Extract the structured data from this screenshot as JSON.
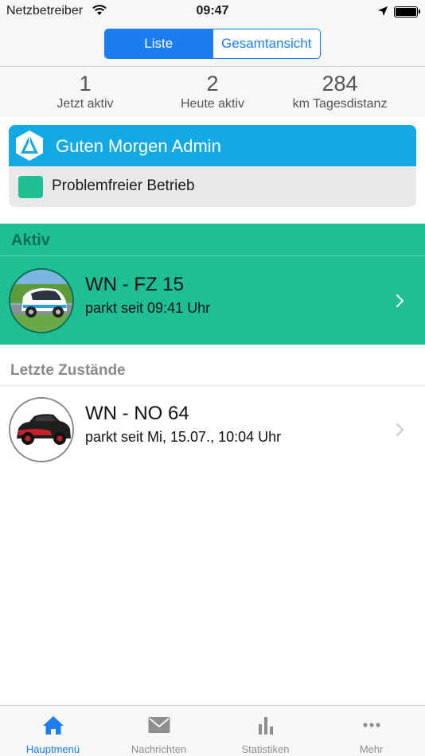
{
  "status_bar": {
    "carrier": "Netzbetreiber",
    "time": "09:47"
  },
  "segment": {
    "tabs": [
      {
        "label": "Liste",
        "active": true
      },
      {
        "label": "Gesamtansicht",
        "active": false
      }
    ]
  },
  "stats": [
    {
      "value": "1",
      "label": "Jetzt aktiv"
    },
    {
      "value": "2",
      "label": "Heute aktiv"
    },
    {
      "value": "284",
      "label": "km Tagesdistanz"
    }
  ],
  "greeting": {
    "title": "Guten Morgen Admin",
    "status_text": "Problemfreier Betrieb",
    "status_color": "#1fbf96",
    "header_color": "#12a9e5"
  },
  "active_section": {
    "header": "Aktiv",
    "color": "#1fbf96",
    "vehicles": [
      {
        "plate": "WN - FZ 15",
        "since": "parkt seit 09:41 Uhr"
      }
    ]
  },
  "last_section": {
    "header": "Letzte Zustände",
    "vehicles": [
      {
        "plate": "WN - NO 64",
        "since": "parkt seit Mi, 15.07., 10:04 Uhr"
      }
    ]
  },
  "tab_bar": {
    "accent": "#1a7ef0",
    "items": [
      {
        "label": "Hauptmenü",
        "icon": "home-icon",
        "active": true
      },
      {
        "label": "Nachrichten",
        "icon": "envelope-icon",
        "active": false
      },
      {
        "label": "Statistiken",
        "icon": "bar-chart-icon",
        "active": false
      },
      {
        "label": "Mehr",
        "icon": "more-dots-icon",
        "active": false
      }
    ]
  }
}
